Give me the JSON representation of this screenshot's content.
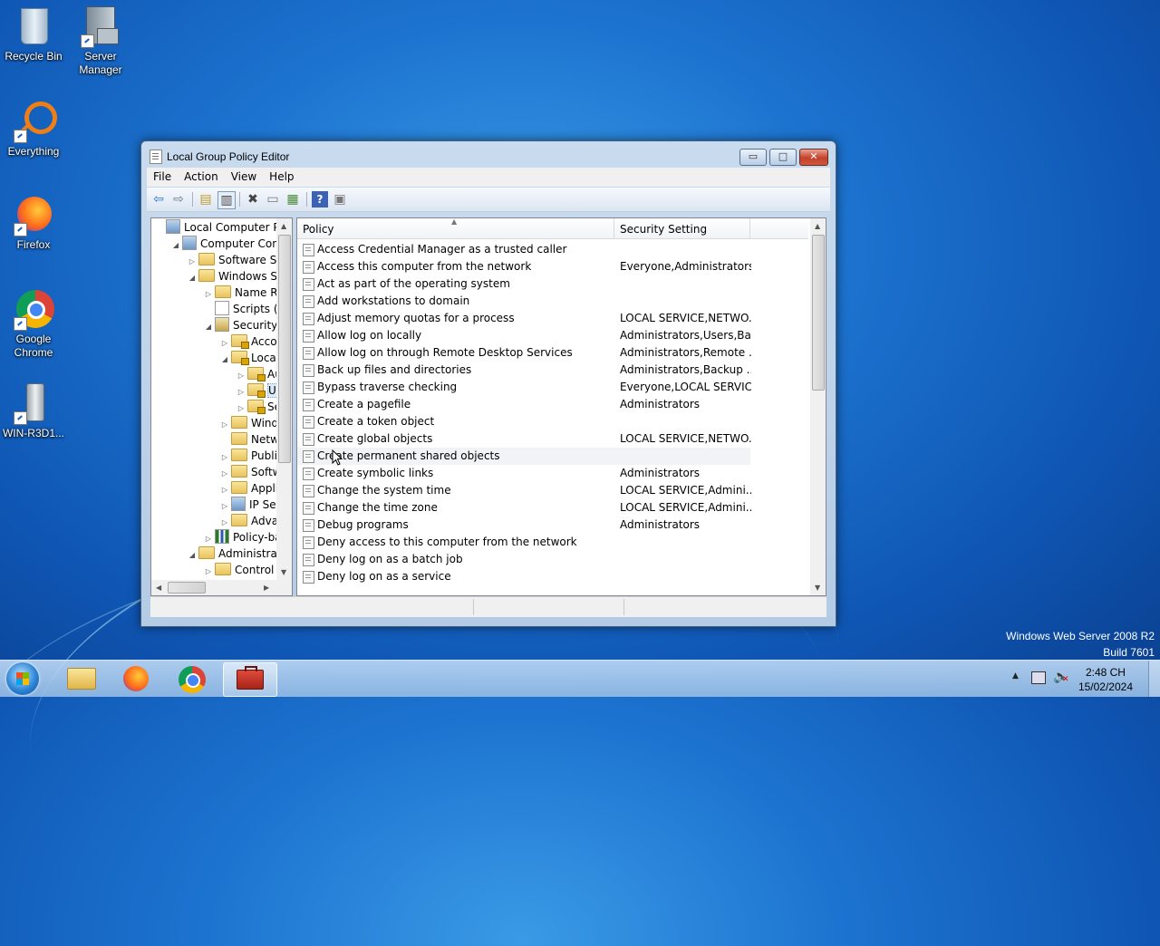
{
  "desktop": {
    "icons": [
      {
        "label": "Recycle Bin",
        "icon": "recycle-bin-icon"
      },
      {
        "label": "Server Manager",
        "icon": "server-manager-icon"
      },
      {
        "label": "Everything",
        "icon": "everything-icon"
      },
      {
        "label": "Firefox",
        "icon": "firefox-icon"
      },
      {
        "label": "Google Chrome",
        "icon": "chrome-icon"
      },
      {
        "label": "WIN-R3D1...",
        "icon": "drive-icon"
      }
    ],
    "watermark": {
      "line1": "Windows Web Server 2008 R2",
      "line2": "Build 7601"
    }
  },
  "window": {
    "title": "Local Group Policy Editor",
    "controls": {
      "minimize": "▭",
      "maximize": "□",
      "close": "✕"
    },
    "menu": [
      "File",
      "Action",
      "View",
      "Help"
    ],
    "tree": [
      {
        "label": "Local Computer Polic",
        "arrow": "",
        "indent": 0,
        "icon": "computer"
      },
      {
        "label": "Computer Config",
        "arrow": "◢",
        "indent": 1,
        "icon": "computer"
      },
      {
        "label": "Software Setti",
        "arrow": "▷",
        "indent": 2,
        "icon": "folder"
      },
      {
        "label": "Windows Sett",
        "arrow": "◢",
        "indent": 2,
        "icon": "folder"
      },
      {
        "label": "Name Res",
        "arrow": "▷",
        "indent": 3,
        "icon": "folder"
      },
      {
        "label": "Scripts (Sta",
        "arrow": "",
        "indent": 3,
        "icon": "doc"
      },
      {
        "label": "Security Se",
        "arrow": "◢",
        "indent": 3,
        "icon": "security"
      },
      {
        "label": "Accou",
        "arrow": "▷",
        "indent": 4,
        "icon": "lockfolder"
      },
      {
        "label": "Local P",
        "arrow": "◢",
        "indent": 4,
        "icon": "lockfolder"
      },
      {
        "label": "Au",
        "arrow": "▷",
        "indent": 5,
        "icon": "lockfolder"
      },
      {
        "label": "Use",
        "arrow": "▷",
        "indent": 5,
        "icon": "lockfolder",
        "selected": true
      },
      {
        "label": "Sec",
        "arrow": "▷",
        "indent": 5,
        "icon": "lockfolder"
      },
      {
        "label": "Windo",
        "arrow": "▷",
        "indent": 4,
        "icon": "folder"
      },
      {
        "label": "Netwo",
        "arrow": "",
        "indent": 4,
        "icon": "folder"
      },
      {
        "label": "Public",
        "arrow": "▷",
        "indent": 4,
        "icon": "folder"
      },
      {
        "label": "Softwa",
        "arrow": "▷",
        "indent": 4,
        "icon": "folder"
      },
      {
        "label": "Applic",
        "arrow": "▷",
        "indent": 4,
        "icon": "folder"
      },
      {
        "label": "IP Secu",
        "arrow": "▷",
        "indent": 4,
        "icon": "computer"
      },
      {
        "label": "Advan",
        "arrow": "▷",
        "indent": 4,
        "icon": "folder"
      },
      {
        "label": "Policy-bas",
        "arrow": "▷",
        "indent": 3,
        "icon": "chart"
      },
      {
        "label": "Administrative",
        "arrow": "◢",
        "indent": 2,
        "icon": "folder"
      },
      {
        "label": "Control Pa",
        "arrow": "▷",
        "indent": 3,
        "icon": "folder"
      }
    ],
    "list": {
      "columns": {
        "policy": "Policy",
        "setting": "Security Setting"
      },
      "rows": [
        {
          "policy": "Access Credential Manager as a trusted caller",
          "setting": ""
        },
        {
          "policy": "Access this computer from the network",
          "setting": "Everyone,Administrators..."
        },
        {
          "policy": "Act as part of the operating system",
          "setting": ""
        },
        {
          "policy": "Add workstations to domain",
          "setting": ""
        },
        {
          "policy": "Adjust memory quotas for a process",
          "setting": "LOCAL SERVICE,NETWO..."
        },
        {
          "policy": "Allow log on locally",
          "setting": "Administrators,Users,Ba..."
        },
        {
          "policy": "Allow log on through Remote Desktop Services",
          "setting": "Administrators,Remote ..."
        },
        {
          "policy": "Back up files and directories",
          "setting": "Administrators,Backup ..."
        },
        {
          "policy": "Bypass traverse checking",
          "setting": "Everyone,LOCAL SERVIC..."
        },
        {
          "policy": "Create a pagefile",
          "setting": "Administrators"
        },
        {
          "policy": "Create a token object",
          "setting": ""
        },
        {
          "policy": "Create global objects",
          "setting": "LOCAL SERVICE,NETWO..."
        },
        {
          "policy": "Create permanent shared objects",
          "setting": "",
          "hover": true
        },
        {
          "policy": "Create symbolic links",
          "setting": "Administrators"
        },
        {
          "policy": "Change the system time",
          "setting": "LOCAL SERVICE,Admini..."
        },
        {
          "policy": "Change the time zone",
          "setting": "LOCAL SERVICE,Admini..."
        },
        {
          "policy": "Debug programs",
          "setting": "Administrators"
        },
        {
          "policy": "Deny access to this computer from the network",
          "setting": ""
        },
        {
          "policy": "Deny log on as a batch job",
          "setting": ""
        },
        {
          "policy": "Deny log on as a service",
          "setting": ""
        }
      ]
    }
  },
  "taskbar": {
    "clock": {
      "time": "2:48 CH",
      "date": "15/02/2024"
    }
  }
}
